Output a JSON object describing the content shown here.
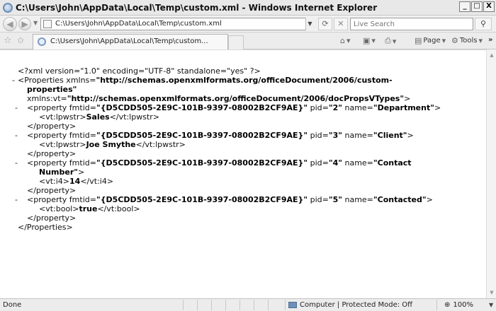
{
  "window": {
    "title": "C:\\Users\\John\\AppData\\Local\\Temp\\custom.xml - Windows Internet Explorer",
    "minimize": "_",
    "maximize": "□",
    "close": "X"
  },
  "address": {
    "url": "C:\\Users\\John\\AppData\\Local\\Temp\\custom.xml",
    "search_placeholder": "Live Search"
  },
  "tab": {
    "label": "C:\\Users\\John\\AppData\\Local\\Temp\\custom..."
  },
  "commands": {
    "page": "Page",
    "tools": "Tools",
    "more": "»"
  },
  "xml": {
    "declaration": "<?xml version=\"1.0\" encoding=\"UTF-8\" standalone=\"yes\" ?>",
    "properties_open_a": "<Properties xmlns=",
    "properties_ns_a": "\"http://schemas.openxmlformats.org/officeDocument/2006/custom-",
    "properties_ns_b": "properties\"",
    "vt_attr": "xmlns:vt=",
    "vt_ns": "\"http://schemas.openxmlformats.org/officeDocument/2006/docPropsVTypes\"",
    "vt_close": ">",
    "properties_close": "</Properties>",
    "property_close": "</property>",
    "props": [
      {
        "open": "<property fmtid=",
        "fmtid": "\"{D5CDD505-2E9C-101B-9397-08002B2CF9AE}\"",
        "pid_attr": " pid=",
        "pid": "\"2\"",
        "name_attr": " name=",
        "name": "\"Department\"",
        "name_cont": "",
        "tail": ">",
        "value_open": "<vt:lpwstr>",
        "value": "Sales",
        "value_close": "</vt:lpwstr>"
      },
      {
        "open": "<property fmtid=",
        "fmtid": "\"{D5CDD505-2E9C-101B-9397-08002B2CF9AE}\"",
        "pid_attr": " pid=",
        "pid": "\"3\"",
        "name_attr": " name=",
        "name": "\"Client\"",
        "name_cont": "",
        "tail": ">",
        "value_open": "<vt:lpwstr>",
        "value": "Joe Smythe",
        "value_close": "</vt:lpwstr>"
      },
      {
        "open": "<property fmtid=",
        "fmtid": "\"{D5CDD505-2E9C-101B-9397-08002B2CF9AE}\"",
        "pid_attr": " pid=",
        "pid": "\"4\"",
        "name_attr": " name=",
        "name": "\"Contact",
        "name_cont": "Number\"",
        "tail": ">",
        "value_open": "<vt:i4>",
        "value": "14",
        "value_close": "</vt:i4>"
      },
      {
        "open": "<property fmtid=",
        "fmtid": "\"{D5CDD505-2E9C-101B-9397-08002B2CF9AE}\"",
        "pid_attr": " pid=",
        "pid": "\"5\"",
        "name_attr": " name=",
        "name": "\"Contacted\"",
        "name_cont": "",
        "tail": ">",
        "value_open": "<vt:bool>",
        "value": "true",
        "value_close": "</vt:bool>"
      }
    ],
    "collapse_marker": "-"
  },
  "status": {
    "left": "Done",
    "zone": "Computer | Protected Mode: Off",
    "zoom": "100%"
  }
}
